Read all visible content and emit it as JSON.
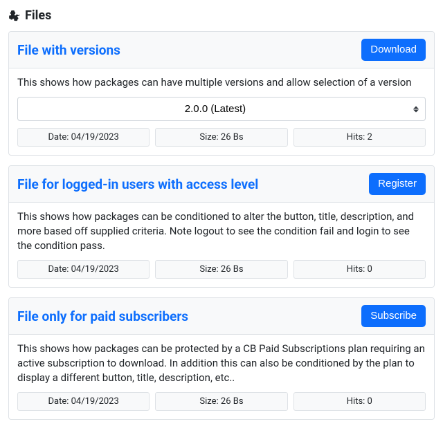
{
  "page": {
    "title": "Files"
  },
  "files": [
    {
      "title": "File with versions",
      "button": "Download",
      "description": "This shows how packages can have multiple versions and allow selection of a version",
      "version_selected": "2.0.0 (Latest)",
      "stats": {
        "date": "Date: 04/19/2023",
        "size": "Size: 26 Bs",
        "hits": "Hits: 2"
      }
    },
    {
      "title": "File for logged-in users with access level",
      "button": "Register",
      "description": "This shows how packages can be conditioned to alter the button, title, description, and more based off supplied criteria. Note logout to see the condition fail and login to see the condition pass.",
      "stats": {
        "date": "Date: 04/19/2023",
        "size": "Size: 26 Bs",
        "hits": "Hits: 0"
      }
    },
    {
      "title": "File only for paid subscribers",
      "button": "Subscribe",
      "description": "This shows how packages can be protected by a CB Paid Subscriptions plan requiring an active subscription to download. In addition this can also be conditioned by the plan to display a different button, title, description, etc..",
      "stats": {
        "date": "Date: 04/19/2023",
        "size": "Size: 26 Bs",
        "hits": "Hits: 0"
      }
    }
  ]
}
